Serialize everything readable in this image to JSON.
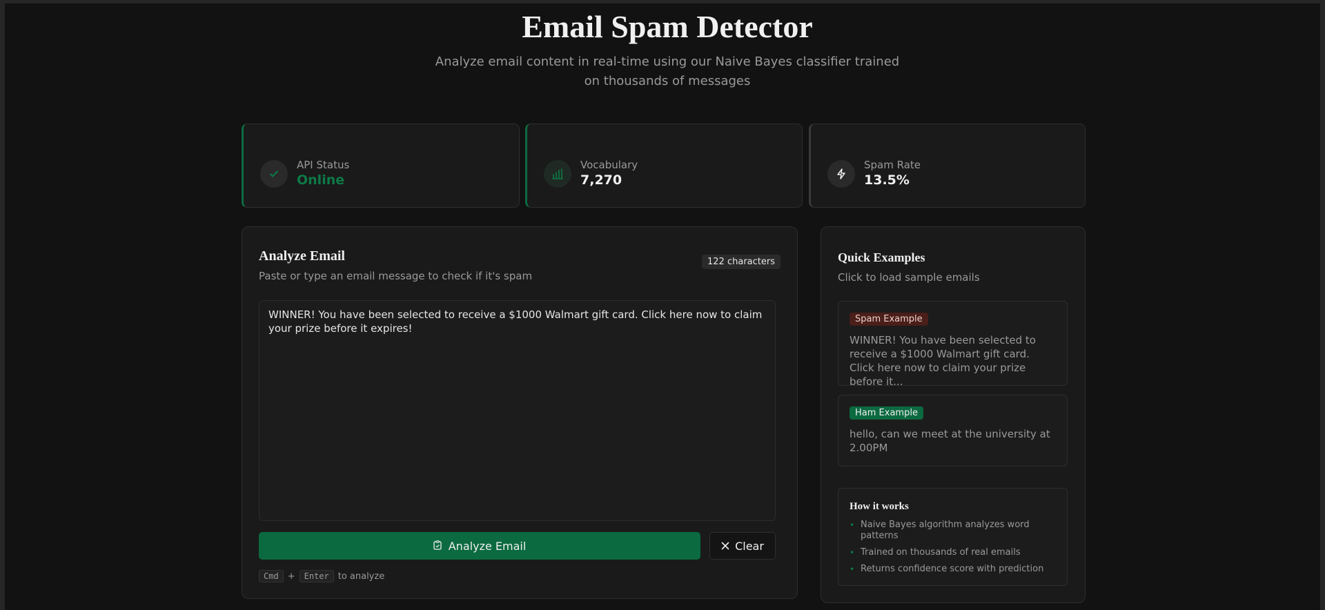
{
  "header": {
    "title": "Email Spam Detector",
    "subtitle": "Analyze email content in real-time using our Naive Bayes classifier trained on thousands of messages"
  },
  "stats": [
    {
      "label": "API Status",
      "value": "Online",
      "icon": "check-icon"
    },
    {
      "label": "Vocabulary",
      "value": "7,270",
      "icon": "bar-chart-icon"
    },
    {
      "label": "Spam Rate",
      "value": "13.5%",
      "icon": "lightning-icon"
    }
  ],
  "analyze": {
    "title": "Analyze Email",
    "subtitle": "Paste or type an email message to check if it's spam",
    "char_count": "122 characters",
    "email_text": "WINNER! You have been selected to receive a $1000 Walmart gift card. Click here now to claim your prize before it expires!",
    "analyze_label": "Analyze Email",
    "clear_label": "Clear",
    "hint": {
      "key1": "Cmd",
      "plus": "+",
      "key2": "Enter",
      "suffix": "to analyze"
    }
  },
  "examples": {
    "title": "Quick Examples",
    "subtitle": "Click to load sample emails",
    "items": [
      {
        "tag": "Spam Example",
        "text": "WINNER! You have been selected to receive a $1000 Walmart gift card. Click here now to claim your prize before it..."
      },
      {
        "tag": "Ham Example",
        "text": "hello, can we meet at the university at 2.00PM"
      }
    ]
  },
  "how_it_works": {
    "title": "How it works",
    "items": [
      "Naive Bayes algorithm analyzes word patterns",
      "Trained on thousands of real emails",
      "Returns confidence score with prediction"
    ]
  },
  "colors": {
    "accent": "#0b6a3f",
    "online": "#0d7a47",
    "background": "#121212",
    "spam_tag": "#4a1e19"
  }
}
